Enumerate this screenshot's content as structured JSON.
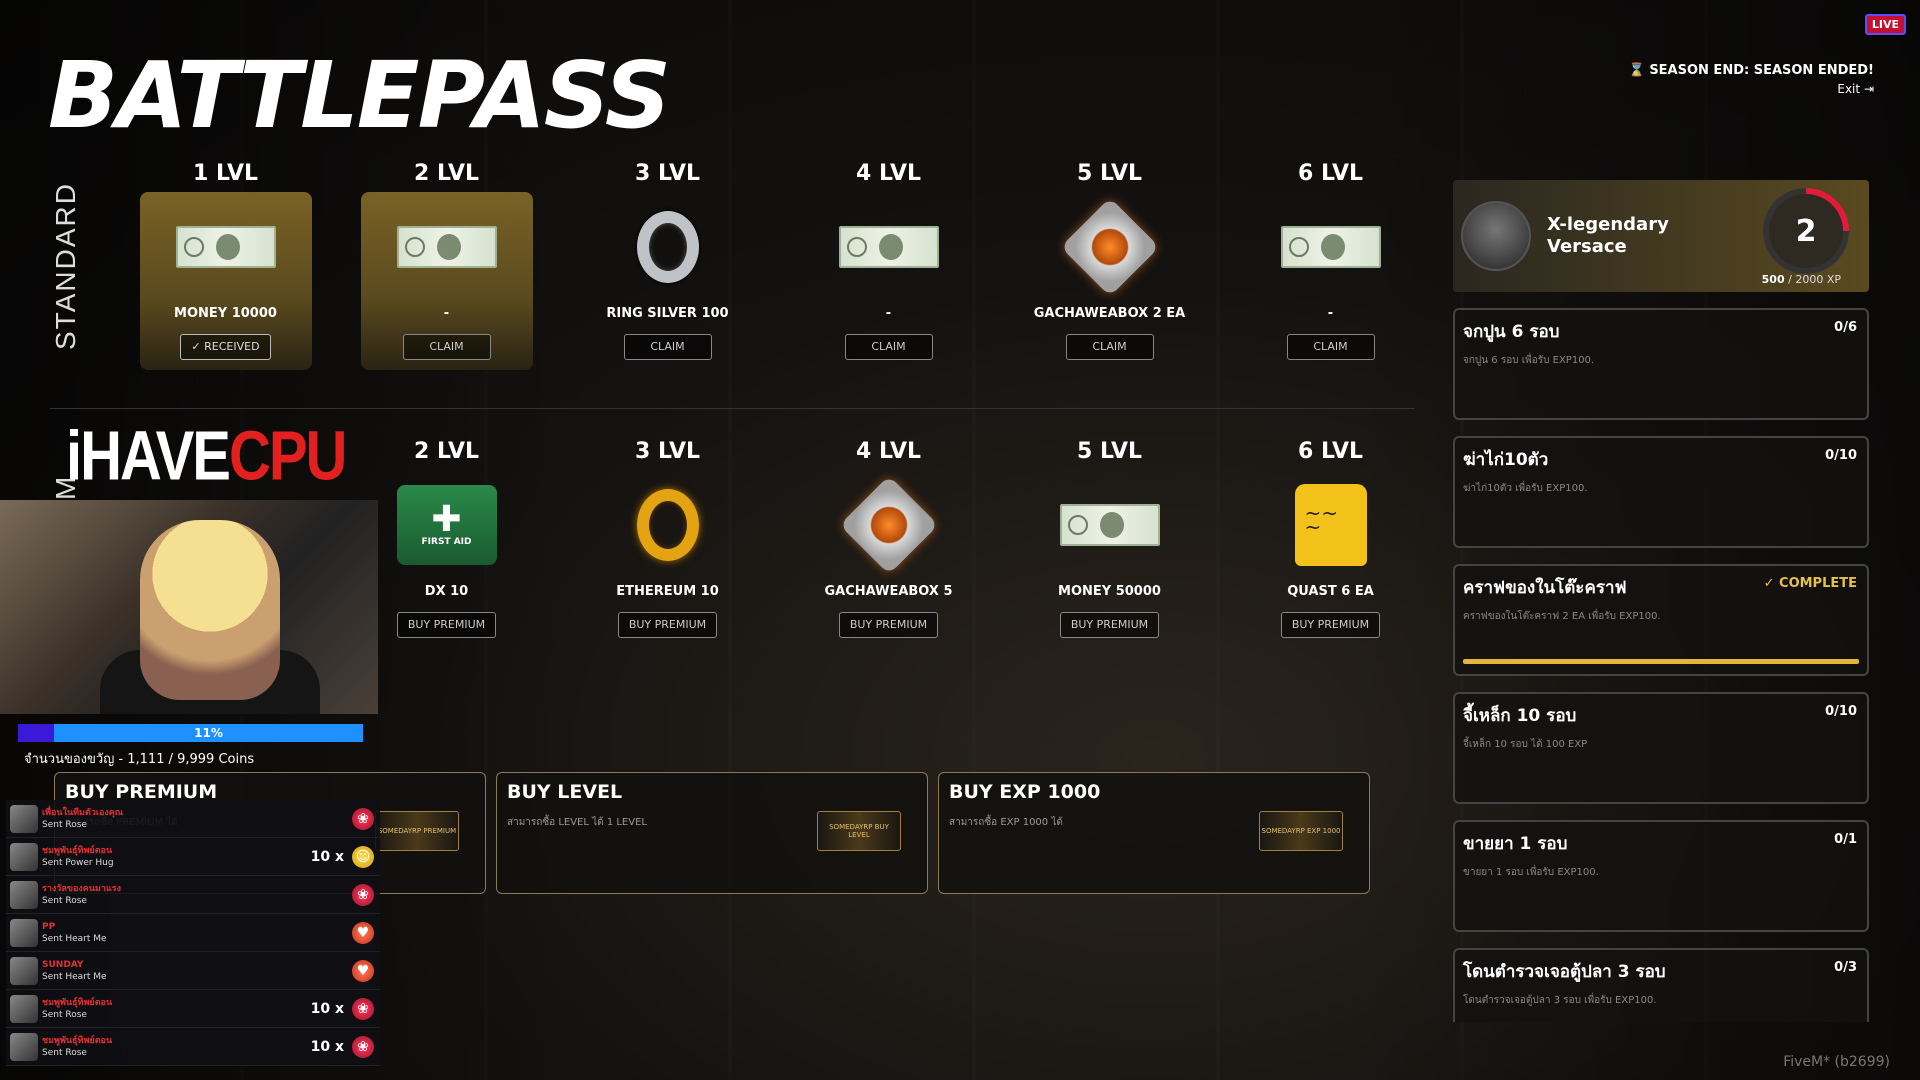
{
  "header": {
    "title": "BATTLEPASS",
    "live": "LIVE",
    "season_status": "SEASON END: SEASON ENDED!",
    "exit_label": "Exit"
  },
  "rows": {
    "standard_label": "STANDARD",
    "premium_label": "M"
  },
  "standard": [
    {
      "level": "1 LVL",
      "name": "MONEY 10000",
      "icon": "money-bill-icon",
      "action": "RECEIVED",
      "highlight": true
    },
    {
      "level": "2 LVL",
      "name": "-",
      "icon": "money-bill-icon",
      "action": "CLAIM",
      "highlight": true
    },
    {
      "level": "3 LVL",
      "name": "RING SILVER 100",
      "icon": "silver-ring-icon",
      "action": "CLAIM",
      "highlight": false
    },
    {
      "level": "4 LVL",
      "name": "-",
      "icon": "money-bill-icon",
      "action": "CLAIM",
      "highlight": false
    },
    {
      "level": "5 LVL",
      "name": "GACHAWEABOX 2 EA",
      "icon": "gacha-box-icon",
      "action": "CLAIM",
      "highlight": false
    },
    {
      "level": "6 LVL",
      "name": "-",
      "icon": "money-bill-icon",
      "action": "CLAIM",
      "highlight": false
    }
  ],
  "premium": [
    {
      "level": "",
      "name": "",
      "icon": "",
      "action": ""
    },
    {
      "level": "2 LVL",
      "name": "DX 10",
      "icon": "first-aid-icon",
      "action": "BUY PREMIUM",
      "first_aid_label": "FIRST AID"
    },
    {
      "level": "3 LVL",
      "name": "ETHEREUM 10",
      "icon": "gold-ring-icon",
      "action": "BUY PREMIUM"
    },
    {
      "level": "4 LVL",
      "name": "GACHAWEABOX 5",
      "icon": "gacha-box-icon",
      "action": "BUY PREMIUM"
    },
    {
      "level": "5 LVL",
      "name": "MONEY 50000",
      "icon": "money-bill-icon",
      "action": "BUY PREMIUM"
    },
    {
      "level": "6 LVL",
      "name": "QUAST 6 EA",
      "icon": "scroll-icon",
      "action": "BUY PREMIUM"
    }
  ],
  "profile": {
    "name": "X-legendary Versace",
    "level": "2",
    "xp_current": "500",
    "xp_total": "/ 2000 XP",
    "xp_fraction": 0.25
  },
  "quests": [
    {
      "title": "จกปูน 6 รอบ",
      "desc": "จกปูน 6 รอบ เพื่อรับ EXP100.",
      "progress": "0/6",
      "complete": false
    },
    {
      "title": "ฆ่าไก่10ตัว",
      "desc": "ฆ่าไก่10ตัว เพื่อรับ EXP100.",
      "progress": "0/10",
      "complete": false
    },
    {
      "title": "คราฟของในโต๊ะคราฟ",
      "desc": "คราฟของในโต๊ะคราฟ 2 EA เพื่อรับ EXP100.",
      "progress": "✓ COMPLETE",
      "complete": true
    },
    {
      "title": "จี้เหล็ก 10 รอบ",
      "desc": "จี้เหล็ก 10 รอบ ได้ 100 EXP",
      "progress": "0/10",
      "complete": false
    },
    {
      "title": "ขายยา 1 รอบ",
      "desc": "ขายยา 1 รอบ เพื่อรับ EXP100.",
      "progress": "0/1",
      "complete": false
    },
    {
      "title": "โดนตำรวจเจอตู้ปลา 3 รอบ",
      "desc": "โดนตำรวจเจอตู้ปลา 3 รอบ เพื่อรับ EXP100.",
      "progress": "0/3",
      "complete": false
    }
  ],
  "shop": [
    {
      "title": "BUY PREMIUM",
      "desc": "สามารถซื้อ PREMIUM ได้",
      "card": "SOMEDAYRP PREMIUM"
    },
    {
      "title": "BUY LEVEL",
      "desc": "สามารถซื้อ LEVEL ได้ 1 LEVEL",
      "card": "SOMEDAYRP BUY LEVEL"
    },
    {
      "title": "BUY EXP 1000",
      "desc": "สามารถซื้อ EXP 1000 ได้",
      "card": "SOMEDAYRP EXP 1000"
    }
  ],
  "stream": {
    "brand_white": "iHAVE",
    "brand_red": "CPU",
    "donate_percent": "11%",
    "donate_fraction": 0.11,
    "donate_text": "จำนวนของขวัญ - 1,111 / 9,999 Coins"
  },
  "chat": [
    {
      "user": "เพื่อนในทีมตัวเองคุณ",
      "msg": "Sent Rose",
      "count": "",
      "gift": "rose"
    },
    {
      "user": "ชมพูพันธุ์ทิพย์ตอน",
      "msg": "Sent Power Hug",
      "count": "10 x",
      "gift": "hug"
    },
    {
      "user": "รางวัลของคนมาแรง",
      "msg": "Sent Rose",
      "count": "",
      "gift": "rose"
    },
    {
      "user": "PP",
      "msg": "Sent Heart Me",
      "count": "",
      "gift": "heart"
    },
    {
      "user": "SUNDAY",
      "msg": "Sent Heart Me",
      "count": "",
      "gift": "heart"
    },
    {
      "user": "ชมพูพันธุ์ทิพย์ตอน",
      "msg": "Sent Rose",
      "count": "10 x",
      "gift": "rose"
    },
    {
      "user": "ชมพูพันธุ์ทิพย์ตอน",
      "msg": "Sent Rose",
      "count": "10 x",
      "gift": "rose"
    }
  ],
  "footer": {
    "build": "FiveM* (b2699)"
  }
}
